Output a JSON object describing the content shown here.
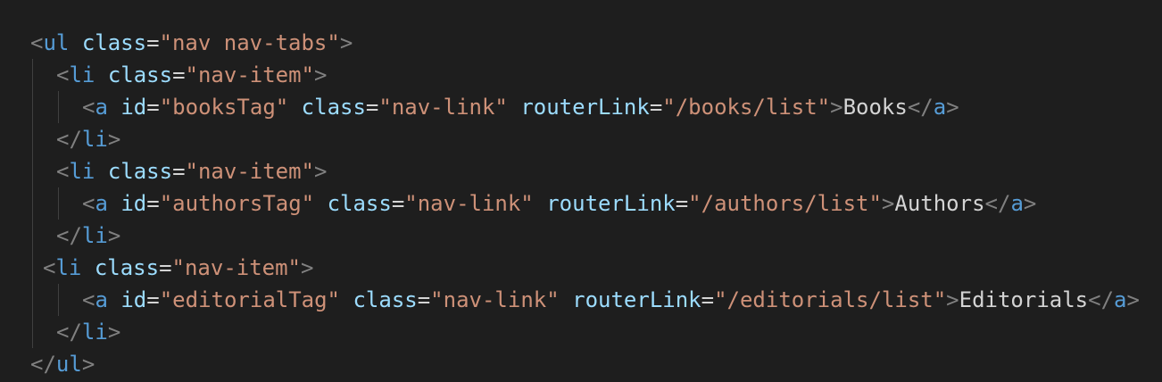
{
  "code": {
    "line1": {
      "open": "<",
      "tag": "ul",
      "attr1": "class",
      "eq1": "=",
      "val1": "\"nav nav-tabs\"",
      "close": ">"
    },
    "line2": {
      "open": "<",
      "tag": "li",
      "attr1": "class",
      "eq1": "=",
      "val1": "\"nav-item\"",
      "close": ">"
    },
    "line3": {
      "open": "<",
      "tag": "a",
      "attr1": "id",
      "eq1": "=",
      "val1": "\"booksTag\"",
      "attr2": "class",
      "eq2": "=",
      "val2": "\"nav-link\"",
      "attr3": "routerLink",
      "eq3": "=",
      "val3": "\"/books/list\"",
      "close": ">",
      "text": "Books",
      "end_open": "</",
      "end_tag": "a",
      "end_close": ">"
    },
    "line4": {
      "open": "</",
      "tag": "li",
      "close": ">"
    },
    "line5": {
      "open": "<",
      "tag": "li",
      "attr1": "class",
      "eq1": "=",
      "val1": "\"nav-item\"",
      "close": ">"
    },
    "line6": {
      "open": "<",
      "tag": "a",
      "attr1": "id",
      "eq1": "=",
      "val1": "\"authorsTag\"",
      "attr2": "class",
      "eq2": "=",
      "val2": "\"nav-link\"",
      "attr3": "routerLink",
      "eq3": "=",
      "val3": "\"/authors/list\"",
      "close": ">",
      "text": "Authors",
      "end_open": "</",
      "end_tag": "a",
      "end_close": ">"
    },
    "line7": {
      "open": "</",
      "tag": "li",
      "close": ">"
    },
    "line8": {
      "open": "<",
      "tag": "li",
      "attr1": "class",
      "eq1": "=",
      "val1": "\"nav-item\"",
      "close": ">"
    },
    "line9": {
      "open": "<",
      "tag": "a",
      "attr1": "id",
      "eq1": "=",
      "val1": "\"editorialTag\"",
      "attr2": "class",
      "eq2": "=",
      "val2": "\"nav-link\"",
      "attr3": "routerLink",
      "eq3": "=",
      "val3": "\"/editorials/list\"",
      "close": ">",
      "text": "Editorials",
      "end_open": "</",
      "end_tag": "a",
      "end_close": ">"
    },
    "line10": {
      "open": "</",
      "tag": "li",
      "close": ">"
    },
    "line11": {
      "open": "</",
      "tag": "ul",
      "close": ">"
    }
  },
  "colors": {
    "background": "#1e1e1e",
    "bracket": "#808080",
    "tag": "#569cd6",
    "attribute": "#9cdcfe",
    "string": "#ce9178",
    "text": "#d4d4d4"
  }
}
